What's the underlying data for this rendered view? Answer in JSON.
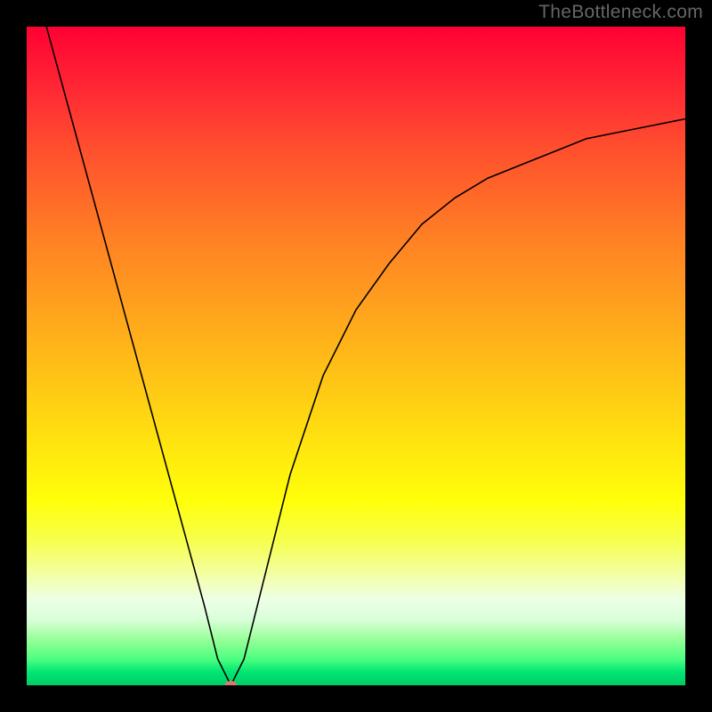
{
  "watermark_text": "TheBottleneck.com",
  "chart_data": {
    "type": "line",
    "title": "",
    "xlabel": "",
    "ylabel": "",
    "xlim": [
      0,
      100
    ],
    "ylim": [
      0,
      100
    ],
    "grid": false,
    "legend": false,
    "series": [
      {
        "name": "bottleneck-curve",
        "x": [
          3,
          6,
          9,
          12,
          15,
          18,
          21,
          24,
          27,
          29,
          31,
          33,
          36,
          40,
          45,
          50,
          55,
          60,
          65,
          70,
          75,
          80,
          85,
          90,
          95,
          100
        ],
        "y": [
          100,
          89,
          78,
          67,
          56,
          45,
          34,
          23,
          12,
          4,
          0,
          4,
          16,
          32,
          47,
          57,
          64,
          70,
          74,
          77,
          79,
          81,
          83,
          84,
          85,
          86
        ]
      }
    ],
    "annotations": [
      {
        "name": "minimum-point",
        "x": 31,
        "y": 0
      }
    ],
    "background_gradient": {
      "orientation": "vertical",
      "stops": [
        {
          "pos": 0.0,
          "color": "#ff0033"
        },
        {
          "pos": 0.5,
          "color": "#ffcc14"
        },
        {
          "pos": 0.8,
          "color": "#f2ffb3"
        },
        {
          "pos": 1.0,
          "color": "#00cc66"
        }
      ]
    }
  }
}
